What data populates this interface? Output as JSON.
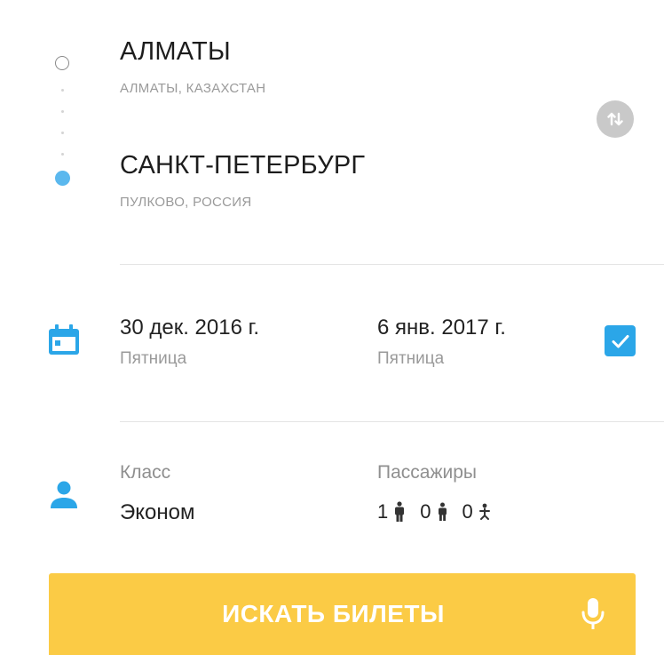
{
  "route": {
    "origin": {
      "city": "АЛМАТЫ",
      "details": "АЛМАТЫ,  КАЗАХСТАН"
    },
    "destination": {
      "city": "САНКТ-ПЕТЕРБУРГ",
      "details": "ПУЛКОВО,  РОССИЯ"
    },
    "swap_icon": "swap-vertical-icon"
  },
  "dates": {
    "icon": "calendar-icon",
    "departure": {
      "date": "30 дек. 2016 г.",
      "weekday": "Пятница"
    },
    "return": {
      "date": "6 янв. 2017 г.",
      "weekday": "Пятница"
    },
    "return_enabled": true
  },
  "trip": {
    "icon": "person-icon",
    "class_label": "Класс",
    "class_value": "Эконом",
    "passengers_label": "Пассажиры",
    "adults": "1",
    "children": "0",
    "infants": "0"
  },
  "search": {
    "label": "ИСКАТЬ БИЛЕТЫ",
    "mic_icon": "microphone-icon"
  },
  "colors": {
    "accent_blue": "#2ba6e8",
    "dest_dot": "#5bb8ee",
    "button_yellow": "#fbcb45"
  }
}
